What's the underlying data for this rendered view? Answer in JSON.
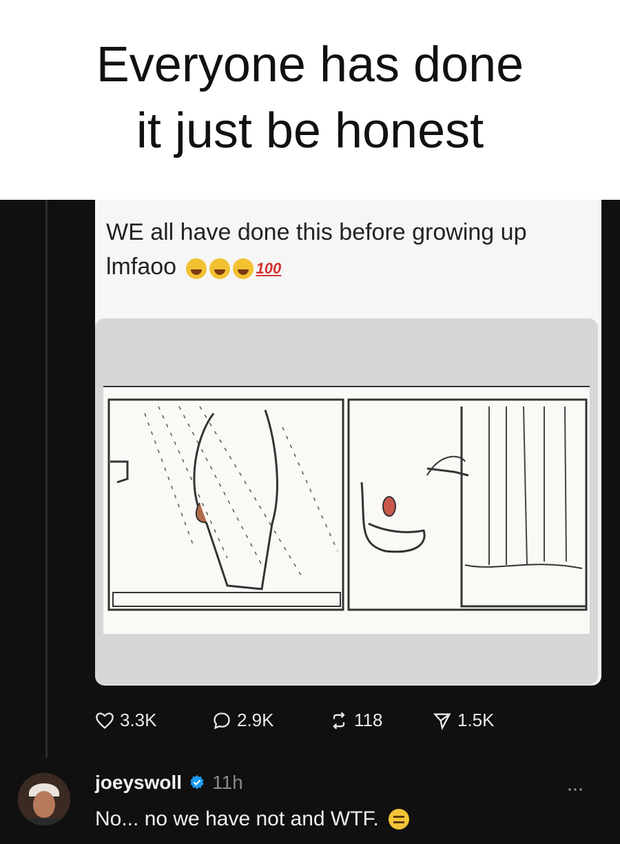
{
  "caption": {
    "line1": "Everyone has done",
    "line2": "it just be honest"
  },
  "post": {
    "text": "WE all have done this before growing up lmfaoo",
    "emoji_count_laughing": 3,
    "hundred_label": "100"
  },
  "actions": {
    "likes": "3.3K",
    "comments": "2.9K",
    "reposts": "118",
    "shares": "1.5K"
  },
  "reply": {
    "username": "joeyswoll",
    "time": "11h",
    "text": "No... no we have not and WTF.",
    "more": "···"
  },
  "colors": {
    "dark_bg": "#101010",
    "verified": "#1d9bf0",
    "caption_bg": "#ffffff"
  }
}
